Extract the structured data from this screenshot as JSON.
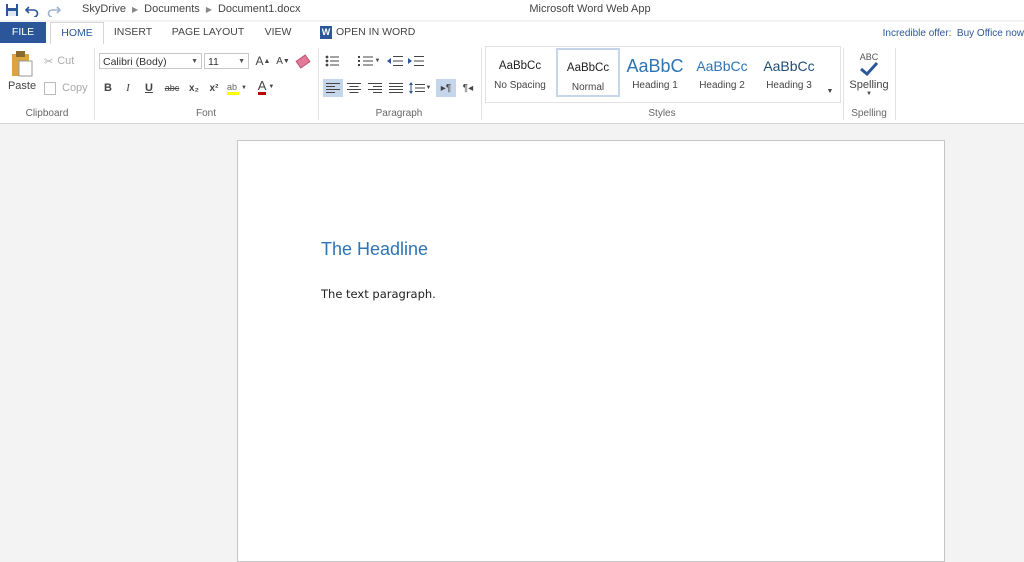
{
  "titlebar": {
    "breadcrumb": [
      "SkyDrive",
      "Documents",
      "Document1.docx"
    ],
    "app_title": "Microsoft Word Web App"
  },
  "tabs": {
    "file": "FILE",
    "home": "HOME",
    "insert": "INSERT",
    "page_layout": "PAGE LAYOUT",
    "view": "VIEW",
    "open_in_word": "OPEN IN WORD"
  },
  "offer": {
    "label": "Incredible offer:",
    "link": "Buy Office now"
  },
  "clipboard": {
    "paste": "Paste",
    "cut": "Cut",
    "copy": "Copy",
    "group": "Clipboard"
  },
  "font": {
    "family": "Calibri (Body)",
    "size": "11",
    "group": "Font",
    "bold": "B",
    "italic": "I",
    "underline": "U",
    "strike": "abc",
    "subscript": "x₂",
    "superscript": "x²",
    "font_color_glyph": "A",
    "grow_glyph": "A",
    "shrink_glyph": "A"
  },
  "paragraph": {
    "group": "Paragraph"
  },
  "styles": {
    "group": "Styles",
    "items": [
      {
        "sample": "AaBbCc",
        "name": "No Spacing"
      },
      {
        "sample": "AaBbCc",
        "name": "Normal"
      },
      {
        "sample": "AaBbC",
        "name": "Heading 1"
      },
      {
        "sample": "AaBbCc",
        "name": "Heading 2"
      },
      {
        "sample": "AaBbCc",
        "name": "Heading 3"
      }
    ]
  },
  "spelling": {
    "abc": "ABC",
    "label": "Spelling",
    "group": "Spelling"
  },
  "document": {
    "headline": "The Headline",
    "paragraph": "The text paragraph."
  },
  "colors": {
    "accent": "#2b579a",
    "heading": "#2e74b5",
    "highlight": "#ffff00",
    "font_color": "#c00000"
  }
}
